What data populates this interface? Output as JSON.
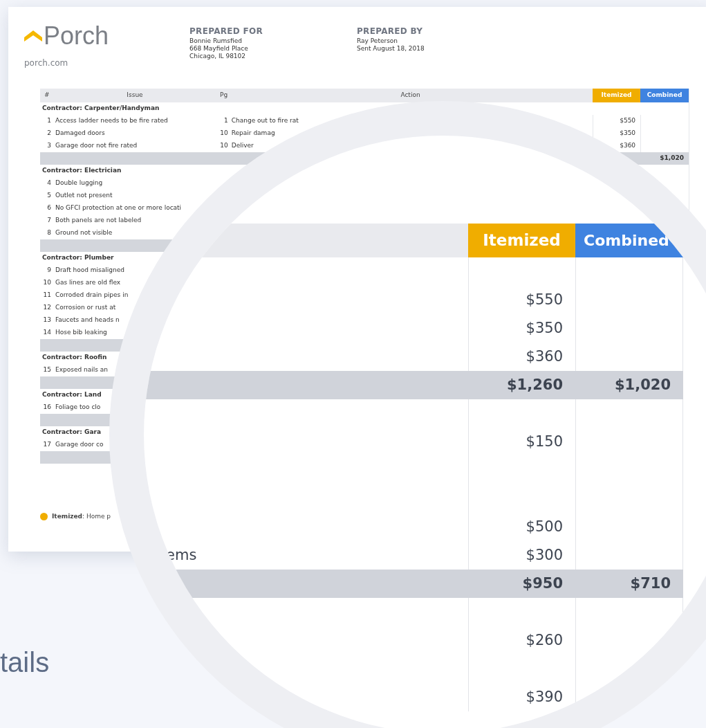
{
  "brand": {
    "name": "Porch",
    "url": "porch.com"
  },
  "prepared_for": {
    "heading": "PREPARED FOR",
    "lines": [
      "Bonnie Rumsfied",
      "668 Mayfield Place",
      "Chicago, IL 98102"
    ]
  },
  "prepared_by": {
    "heading": "PREPARED BY",
    "lines": [
      "Ray Peterson",
      "Sent August 18, 2018"
    ]
  },
  "table": {
    "columns": [
      "#",
      "Issue",
      "Pg",
      "Action",
      "Itemized",
      "Combined"
    ],
    "sections": [
      {
        "contractor": "Contractor: Carpenter/Handyman",
        "items": [
          {
            "num": "1",
            "issue": "Access ladder needs to be fire rated",
            "pg": "1",
            "action": "Change out to fire rat",
            "itemized": "$550"
          },
          {
            "num": "2",
            "issue": "Damaged doors",
            "pg": "10",
            "action": "Repair damag",
            "itemized": "$350"
          },
          {
            "num": "3",
            "issue": "Garage door not fire rated",
            "pg": "10",
            "action": "Deliver",
            "itemized": "$360"
          }
        ],
        "subtotal_combined": "$1,020"
      },
      {
        "contractor": "Contractor: Electrician",
        "items": [
          {
            "num": "4",
            "issue": "Double lugging"
          },
          {
            "num": "5",
            "issue": "Outlet not present"
          },
          {
            "num": "6",
            "issue": "No GFCI protection at one or more locati"
          },
          {
            "num": "7",
            "issue": "Both panels are not labeled"
          },
          {
            "num": "8",
            "issue": "Ground not visible"
          }
        ]
      },
      {
        "contractor": "Contractor: Plumber",
        "items": [
          {
            "num": "9",
            "issue": "Draft hood misaligned"
          },
          {
            "num": "10",
            "issue": "Gas lines are old flex"
          },
          {
            "num": "11",
            "issue": "Corroded drain pipes in"
          },
          {
            "num": "12",
            "issue": "Corrosion or rust at"
          },
          {
            "num": "13",
            "issue": "Faucets and heads n"
          },
          {
            "num": "14",
            "issue": "Hose bib leaking"
          }
        ]
      },
      {
        "contractor": "Contractor: Roofin",
        "items": [
          {
            "num": "15",
            "issue": "Exposed nails an"
          }
        ]
      },
      {
        "contractor": "Contractor: Land",
        "items": [
          {
            "num": "16",
            "issue": "Foliage too clo"
          }
        ]
      },
      {
        "contractor": "Contractor: Gara",
        "items": [
          {
            "num": "17",
            "issue": "Garage door co"
          }
        ]
      }
    ]
  },
  "legend": {
    "text": "**Itemized**: Home p",
    "color": "#f0ad00"
  },
  "magnifier": {
    "columns": [
      "Itemized",
      "Combined"
    ],
    "rows": [
      {
        "kind": "blank"
      },
      {
        "kind": "item",
        "itemized": "$550"
      },
      {
        "kind": "item",
        "itemized": "$350"
      },
      {
        "kind": "item",
        "itemized": "$360"
      },
      {
        "kind": "subtotal",
        "itemized": "$1,260",
        "combined": "$1,020"
      },
      {
        "kind": "blank"
      },
      {
        "kind": "item",
        "itemized": "$150"
      },
      {
        "kind": "blank"
      },
      {
        "kind": "blank"
      },
      {
        "kind": "item",
        "itemized": "$500"
      },
      {
        "kind": "item",
        "label": "ems",
        "itemized": "$300"
      },
      {
        "kind": "subtotal",
        "itemized": "$950",
        "combined": "$710"
      },
      {
        "kind": "blank"
      },
      {
        "kind": "item",
        "itemized": "$260"
      },
      {
        "kind": "blank"
      },
      {
        "kind": "item",
        "itemized": "$390"
      }
    ]
  },
  "background_text": "tails"
}
